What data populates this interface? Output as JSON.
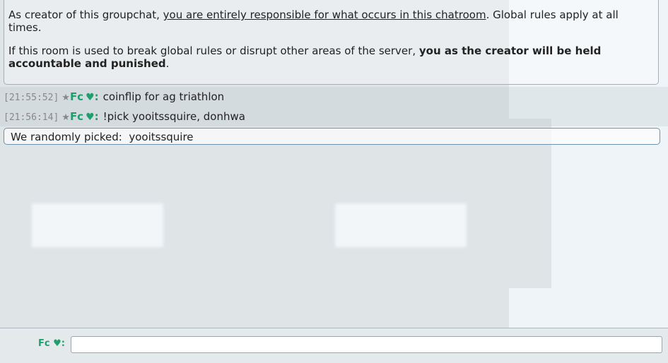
{
  "notice": {
    "p1_start": "As creator of this groupchat, ",
    "p1_underlined": "you are entirely responsible for what occurs in this chatroom",
    "p1_end": ". Global rules apply at all times.",
    "p2_start": "If this room is used to break global rules or disrupt other areas of the server, ",
    "p2_bold": "you as the creator will be held accountable and punished",
    "p2_end": "."
  },
  "messages": [
    {
      "timestamp": "[21:55:52]",
      "rank": "★",
      "user": "Fc",
      "text": "coinflip for ag triathlon"
    },
    {
      "timestamp": "[21:56:14]",
      "rank": "★",
      "user": "Fc",
      "text": "!pick yooitssquire, donhwa"
    }
  ],
  "result": {
    "text": "We randomly picked:  yooitssquire"
  },
  "input_bar": {
    "user": "Fc",
    "value": "",
    "placeholder": ""
  },
  "colors": {
    "user_color": "#1f9f6e",
    "border_color": "#6f93ad",
    "background": "#dfe4e7"
  },
  "icons": {
    "heart": "♥"
  }
}
